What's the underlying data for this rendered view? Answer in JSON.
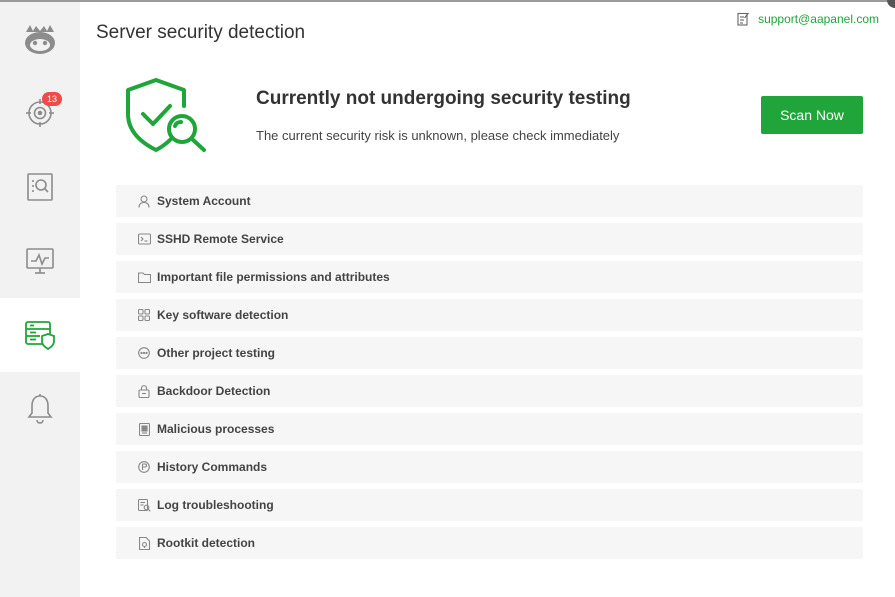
{
  "header": {
    "title": "Server security detection",
    "support_email": "support@aapanel.com"
  },
  "sidebar": {
    "items": [
      {
        "name": "logo",
        "icon": "aapanel-logo"
      },
      {
        "name": "risk-scan",
        "icon": "target-icon",
        "badge": "13"
      },
      {
        "name": "file-scan",
        "icon": "file-search-icon"
      },
      {
        "name": "monitor",
        "icon": "monitor-icon"
      },
      {
        "name": "server-security",
        "icon": "server-shield-icon",
        "active": true
      },
      {
        "name": "alerts",
        "icon": "bell-icon"
      }
    ]
  },
  "status": {
    "title": "Currently not undergoing security testing",
    "description": "The current security risk is unknown, please check immediately",
    "scan_button": "Scan Now"
  },
  "checks": [
    {
      "label": "System Account",
      "icon": "user-icon"
    },
    {
      "label": "SSHD Remote Service",
      "icon": "terminal-icon"
    },
    {
      "label": "Important file permissions and attributes",
      "icon": "folder-icon"
    },
    {
      "label": "Key software detection",
      "icon": "grid-icon"
    },
    {
      "label": "Other project testing",
      "icon": "ellipsis-circle-icon"
    },
    {
      "label": "Backdoor Detection",
      "icon": "lock-box-icon"
    },
    {
      "label": "Malicious processes",
      "icon": "process-icon"
    },
    {
      "label": "History Commands",
      "icon": "history-icon"
    },
    {
      "label": "Log troubleshooting",
      "icon": "log-icon"
    },
    {
      "label": "Rootkit detection",
      "icon": "rootkit-icon"
    }
  ],
  "colors": {
    "accent": "#20a53a",
    "badge": "#ef4b4b",
    "sidebar_bg": "#f2f2f2",
    "row_bg": "#f6f6f6"
  }
}
